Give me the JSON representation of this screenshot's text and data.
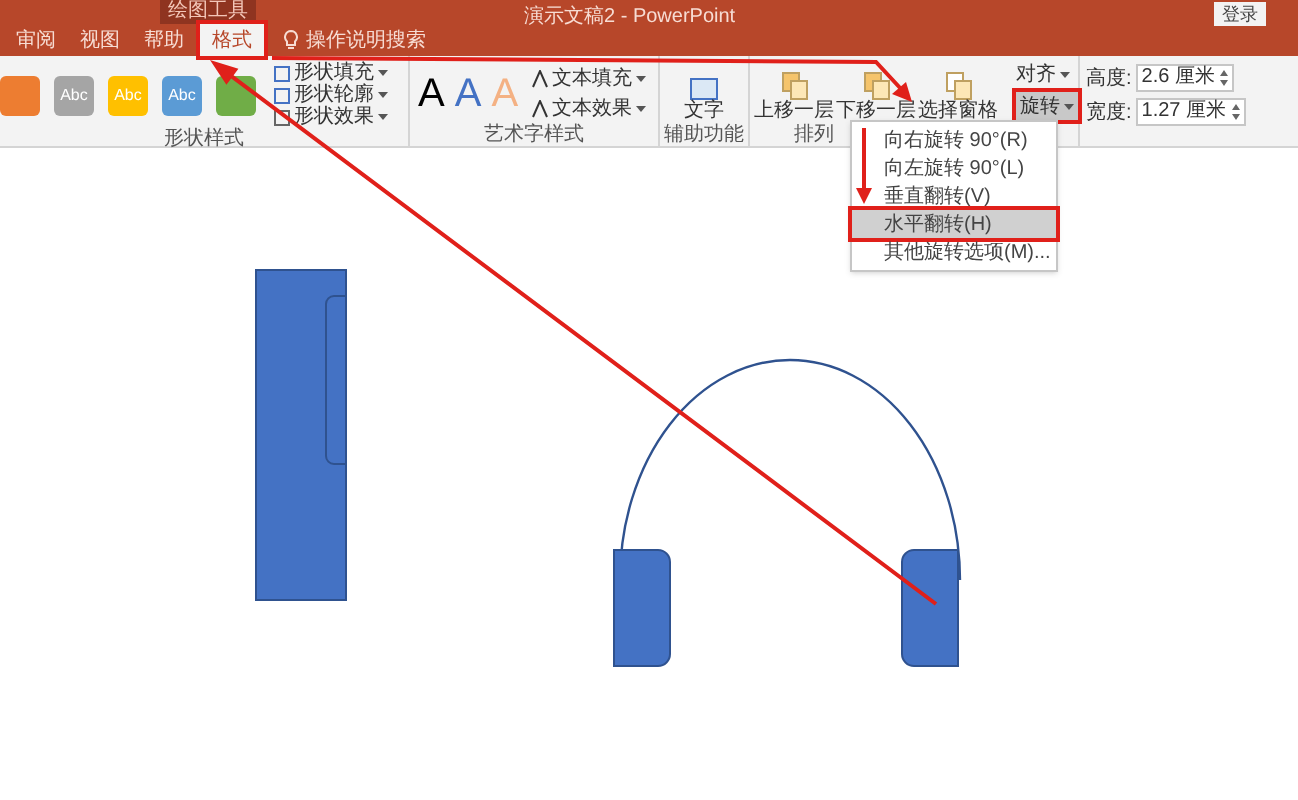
{
  "context_tab": "绘图工具",
  "title": "演示文稿2 - PowerPoint",
  "sign_in": "登录",
  "tabs": [
    {
      "label": "审阅",
      "selected": false
    },
    {
      "label": "视图",
      "selected": false
    },
    {
      "label": "帮助",
      "selected": false
    },
    {
      "label": "格式",
      "selected": true
    }
  ],
  "tell_me": "操作说明搜索",
  "shape_styles": {
    "label": "形状样式",
    "swatches": [
      {
        "color": "#ed7d31"
      },
      {
        "color": "#a5a5a5",
        "label": "Abc"
      },
      {
        "color": "#ffc000",
        "label": "Abc"
      },
      {
        "color": "#5b9bd5",
        "label": "Abc"
      },
      {
        "color": "#70ad47"
      }
    ],
    "commands": [
      "形状填充",
      "形状轮廓",
      "形状效果"
    ]
  },
  "wordart": {
    "label": "艺术字样式",
    "samples": [
      {
        "label": "A",
        "color": "#000000"
      },
      {
        "label": "A",
        "color": "#4472c4"
      },
      {
        "label": "A",
        "color": "#f4b183"
      }
    ],
    "commands": [
      "文本填充",
      "文本效果"
    ]
  },
  "accessibility": {
    "label": "辅助功能",
    "command": "文字"
  },
  "arrange": {
    "label": "排列",
    "commands": [
      "上移一层",
      "下移一层",
      "选择窗格"
    ],
    "align": "对齐",
    "rotate": "旋转"
  },
  "size": {
    "height_label": "高度:",
    "height": "2.6 厘米",
    "width_label": "宽度:",
    "width": "1.27 厘米"
  },
  "rotate_menu": [
    {
      "label": "向右旋转 90°(R)",
      "selected": false
    },
    {
      "label": "向左旋转 90°(L)",
      "selected": false
    },
    {
      "label": "垂直翻转(V)",
      "selected": false
    },
    {
      "label": "水平翻转(H)",
      "selected": true
    },
    {
      "label": "其他旋转选项(M)...",
      "selected": false
    }
  ]
}
